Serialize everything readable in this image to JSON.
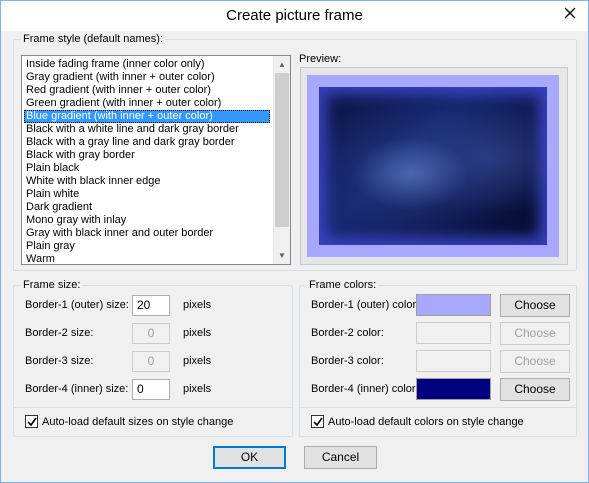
{
  "window": {
    "title": "Create picture frame"
  },
  "frame_style": {
    "label": "Frame style (default names):",
    "items": [
      "Inside fading frame (inner color only)",
      "Gray gradient (with inner + outer color)",
      "Red gradient (with inner + outer color)",
      "Green gradient (with inner + outer color)",
      "Blue gradient (with inner + outer color)",
      "Black with a white line and dark gray border",
      "Black with a gray line and dark gray border",
      "Black with gray border",
      "Plain black",
      "White with black inner edge",
      "Plain white",
      "Dark gradient",
      "Mono gray with inlay",
      "Gray with black inner and outer border",
      "Plain gray",
      "Warm"
    ],
    "selected_index": 4
  },
  "preview": {
    "label": "Preview:"
  },
  "frame_size": {
    "label": "Frame size:",
    "rows": [
      {
        "label": "Border-1 (outer) size:",
        "value": "20",
        "unit": "pixels",
        "enabled": true
      },
      {
        "label": "Border-2 size:",
        "value": "0",
        "unit": "pixels",
        "enabled": false
      },
      {
        "label": "Border-3 size:",
        "value": "0",
        "unit": "pixels",
        "enabled": false
      },
      {
        "label": "Border-4 (inner) size:",
        "value": "0",
        "unit": "pixels",
        "enabled": true
      }
    ],
    "autoload_label": "Auto-load default sizes on style change",
    "autoload_checked": true
  },
  "frame_colors": {
    "label": "Frame colors:",
    "rows": [
      {
        "label": "Border-1 (outer) color:",
        "color": "#a8a8ff",
        "button": "Choose",
        "enabled": true
      },
      {
        "label": "Border-2 color:",
        "color": "#f0f0f0",
        "button": "Choose",
        "enabled": false
      },
      {
        "label": "Border-3 color:",
        "color": "#f0f0f0",
        "button": "Choose",
        "enabled": false
      },
      {
        "label": "Border-4 (inner) color:",
        "color": "#000080",
        "button": "Choose",
        "enabled": true
      }
    ],
    "autoload_label": "Auto-load default colors on style change",
    "autoload_checked": true
  },
  "buttons": {
    "ok": "OK",
    "cancel": "Cancel"
  }
}
